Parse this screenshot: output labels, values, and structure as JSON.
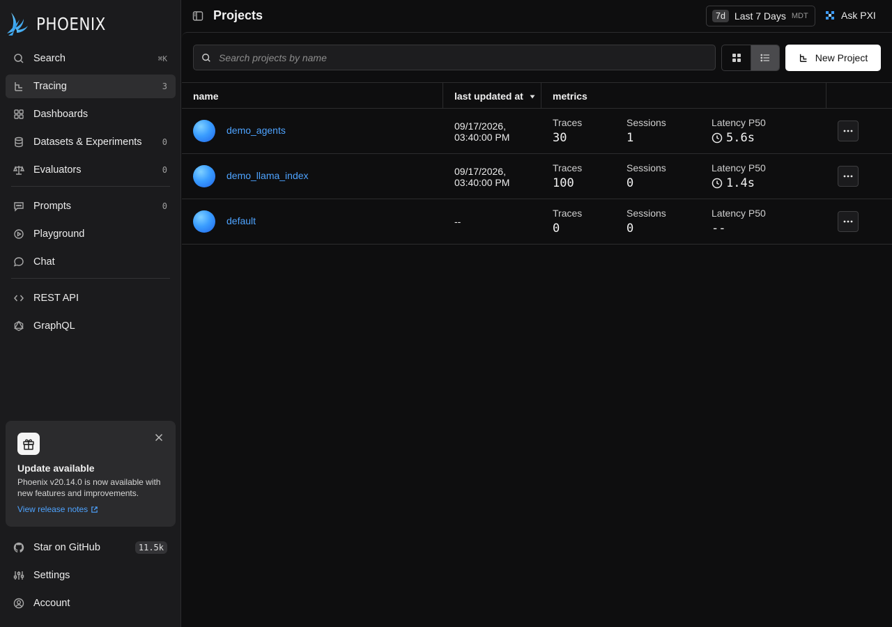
{
  "app": {
    "logo_text": "PHOENIX"
  },
  "sidebar": {
    "nav_primary": [
      {
        "label": "Search",
        "shortcut": "⌘K",
        "icon": "search-icon"
      },
      {
        "label": "Tracing",
        "count": "3",
        "icon": "tracing-icon",
        "active": true
      },
      {
        "label": "Dashboards",
        "icon": "grid-icon"
      },
      {
        "label": "Datasets & Experiments",
        "count": "0",
        "icon": "database-icon"
      },
      {
        "label": "Evaluators",
        "count": "0",
        "icon": "scale-icon"
      }
    ],
    "nav_secondary": [
      {
        "label": "Prompts",
        "count": "0",
        "icon": "message-square-icon"
      },
      {
        "label": "Playground",
        "icon": "play-circle-icon"
      },
      {
        "label": "Chat",
        "icon": "chat-bubble-icon"
      }
    ],
    "nav_tertiary": [
      {
        "label": "REST API",
        "icon": "code-icon"
      },
      {
        "label": "GraphQL",
        "icon": "graphql-icon"
      }
    ],
    "update_card": {
      "title": "Update available",
      "description": "Phoenix v20.14.0 is now available with new features and improvements.",
      "link": "View release notes"
    },
    "nav_bottom": [
      {
        "label": "Star on GitHub",
        "badge": "11.5k",
        "icon": "github-icon"
      },
      {
        "label": "Settings",
        "icon": "sliders-icon"
      },
      {
        "label": "Account",
        "icon": "user-circle-icon"
      }
    ]
  },
  "header": {
    "title": "Projects",
    "time_range": {
      "abbr": "7d",
      "label": "Last 7 Days",
      "tz": "MDT"
    },
    "ask_label": "Ask PXI"
  },
  "toolbar": {
    "search_placeholder": "Search projects by name",
    "new_project_label": "New Project"
  },
  "table": {
    "columns": {
      "name": "name",
      "updated": "last updated at",
      "metrics": "metrics"
    },
    "metric_labels": {
      "traces": "Traces",
      "sessions": "Sessions",
      "latency": "Latency P50"
    },
    "rows": [
      {
        "name": "demo_agents",
        "updated_line1": "09/17/2026,",
        "updated_line2": "03:40:00 PM",
        "traces": "30",
        "sessions": "1",
        "latency": "5.6s"
      },
      {
        "name": "demo_llama_index",
        "updated_line1": "09/17/2026,",
        "updated_line2": "03:40:00 PM",
        "traces": "100",
        "sessions": "0",
        "latency": "1.4s"
      },
      {
        "name": "default",
        "updated_line1": "--",
        "updated_line2": "",
        "traces": "0",
        "sessions": "0",
        "latency": "--"
      }
    ]
  },
  "colors": {
    "accent_link": "#4ea3ff",
    "background": "#0e0e0f",
    "sidebar": "#1b1b1d",
    "primary_button": "#ffffff"
  }
}
